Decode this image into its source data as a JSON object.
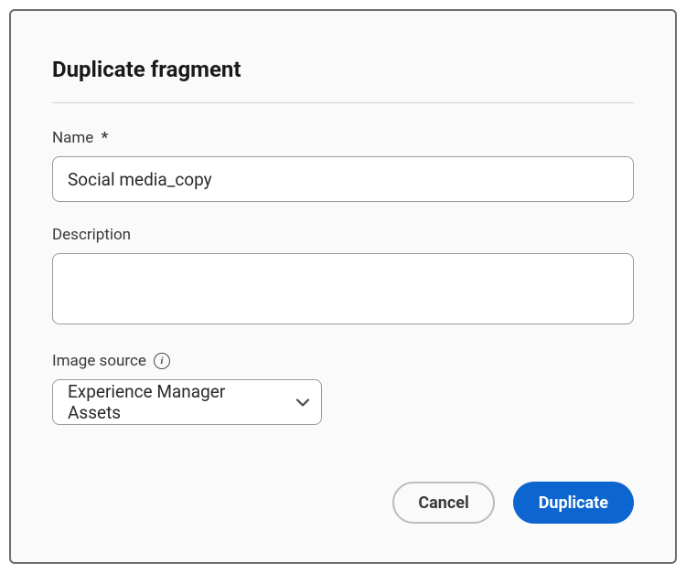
{
  "dialog": {
    "title": "Duplicate fragment",
    "fields": {
      "name": {
        "label": "Name",
        "required_mark": "*",
        "value": "Social media_copy"
      },
      "description": {
        "label": "Description",
        "value": ""
      },
      "image_source": {
        "label": "Image source",
        "selected": "Experience Manager Assets"
      }
    },
    "buttons": {
      "cancel": "Cancel",
      "duplicate": "Duplicate"
    }
  }
}
